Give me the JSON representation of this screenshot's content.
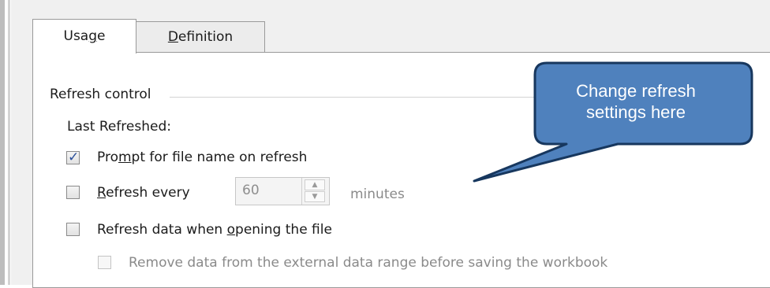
{
  "tabs": [
    {
      "label_pre": "Usa",
      "label_ul": "g",
      "label_post": "e"
    },
    {
      "label_pre": "",
      "label_ul": "D",
      "label_post": "efinition"
    }
  ],
  "refresh_control": {
    "group_label": "Refresh control",
    "last_refreshed_label": "Last Refreshed:",
    "prompt": {
      "pre": "Pro",
      "ul": "m",
      "post": "pt for file name on refresh",
      "checked": true
    },
    "refresh_every": {
      "pre": "",
      "ul": "R",
      "post": "efresh every",
      "checked": false,
      "value": "60",
      "unit": "minutes"
    },
    "refresh_on_open": {
      "pre": "Refresh data when ",
      "ul": "o",
      "post": "pening the file",
      "checked": false
    },
    "remove_data": {
      "label": "Remove data from the external data range before saving the workbook",
      "checked": false,
      "disabled": true
    }
  },
  "callout": {
    "line1": "Change refresh",
    "line2": "settings here",
    "fill": "#4f81bd",
    "stroke": "#17375e"
  },
  "colors": {
    "check": "#2b4f9a",
    "disabled_text": "#8a8a8a"
  }
}
